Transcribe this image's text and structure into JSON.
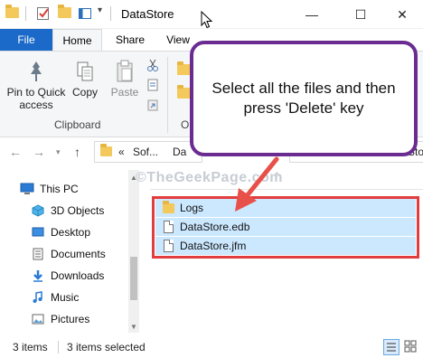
{
  "window": {
    "title": "DataStore",
    "minimize_glyph": "—",
    "maximize_glyph": "☐",
    "close_glyph": "✕"
  },
  "ribbon": {
    "tabs": [
      {
        "label": "File"
      },
      {
        "label": "Home"
      },
      {
        "label": "Share"
      },
      {
        "label": "View"
      }
    ],
    "pin_line1": "Pin to Quick",
    "pin_line2": "access",
    "copy_label": "Copy",
    "paste_label": "Paste",
    "clipboard_group": "Clipboard",
    "organize_group_partial": "O"
  },
  "address": {
    "back_glyph": "←",
    "forward_glyph": "→",
    "up_glyph": "↑",
    "crumb_prefix": "«",
    "crumb_1": "Sof...",
    "crumb_2": "Da",
    "search_partial": "Sto"
  },
  "navigation": {
    "items": [
      {
        "label": "This PC",
        "icon": "computer-icon"
      },
      {
        "label": "3D Objects",
        "icon": "cube-icon"
      },
      {
        "label": "Desktop",
        "icon": "desktop-icon"
      },
      {
        "label": "Documents",
        "icon": "documents-icon"
      },
      {
        "label": "Downloads",
        "icon": "download-icon"
      },
      {
        "label": "Music",
        "icon": "music-icon"
      },
      {
        "label": "Pictures",
        "icon": "pictures-icon"
      }
    ]
  },
  "watermark": "©TheGeekPage.com",
  "files": [
    {
      "name": "Logs",
      "type": "folder"
    },
    {
      "name": "DataStore.edb",
      "type": "file"
    },
    {
      "name": "DataStore.jfm",
      "type": "file"
    }
  ],
  "callout": {
    "text": "Select all the files and then press 'Delete' key"
  },
  "status": {
    "item_count": "3 items",
    "selected": "3 items selected"
  },
  "colors": {
    "accent": "#1b6ac9",
    "selection": "#cce8ff",
    "highlight_border": "#e23d3d",
    "callout_border": "#6a2c91",
    "arrow": "#e8504a"
  }
}
